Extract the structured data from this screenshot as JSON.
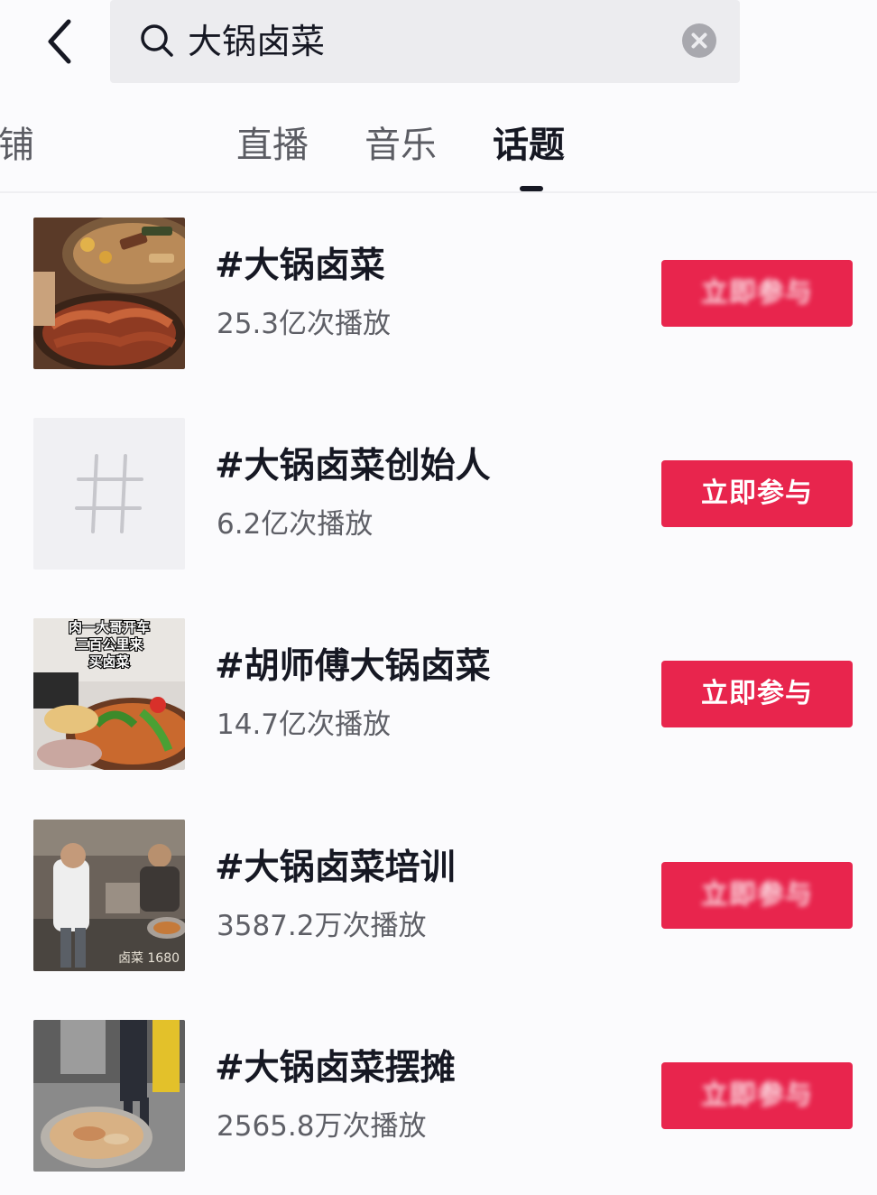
{
  "search": {
    "value": "大锅卤菜"
  },
  "tabs": [
    {
      "label": "店铺"
    },
    {
      "label": "直播"
    },
    {
      "label": "音乐"
    },
    {
      "label": "话题",
      "active": true
    }
  ],
  "topics": [
    {
      "title": "#大锅卤菜",
      "plays": "25.3亿次播放",
      "button": "立即参与"
    },
    {
      "title": "#大锅卤菜创始人",
      "plays": "6.2亿次播放",
      "button": "立即参与",
      "thumb_icon": "hashtag-icon"
    },
    {
      "title": "#胡师傅大锅卤菜",
      "plays": "14.7亿次播放",
      "button": "立即参与"
    },
    {
      "title": "#大锅卤菜培训",
      "plays": "3587.2万次播放",
      "button": "立即参与"
    },
    {
      "title": "#大锅卤菜摆摊",
      "plays": "2565.8万次播放",
      "button": "立即参与"
    }
  ],
  "thumb3_caption": [
    "肉一大哥开车",
    "三百公里来",
    "买卤菜"
  ],
  "thumb4_watermark": "卤菜 1680",
  "colors": {
    "accent": "#e8254d",
    "text_primary": "#161823",
    "text_secondary": "#5e5f66",
    "search_bg": "#ececef"
  }
}
